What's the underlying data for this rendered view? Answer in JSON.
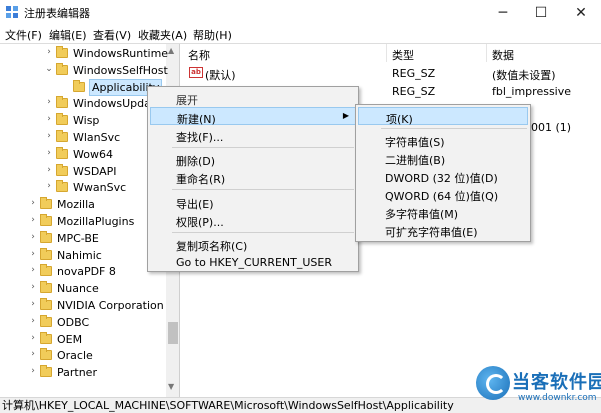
{
  "window": {
    "title": "注册表编辑器"
  },
  "menubar": [
    "文件(F)",
    "编辑(E)",
    "查看(V)",
    "收藏夹(A)",
    "帮助(H)"
  ],
  "tree": [
    {
      "label": "WindowsRuntime",
      "arrow": "›"
    },
    {
      "label": "WindowsSelfHost",
      "arrow": "⌄"
    },
    {
      "label": "Applicability",
      "arrow": "",
      "selected": true
    },
    {
      "label": "WindowsUpdat",
      "arrow": "›"
    },
    {
      "label": "Wisp",
      "arrow": "›"
    },
    {
      "label": "WlanSvc",
      "arrow": "›"
    },
    {
      "label": "Wow64",
      "arrow": "›"
    },
    {
      "label": "WSDAPI",
      "arrow": "›"
    },
    {
      "label": "WwanSvc",
      "arrow": "›"
    },
    {
      "label": "Mozilla",
      "arrow": "›"
    },
    {
      "label": "MozillaPlugins",
      "arrow": "›"
    },
    {
      "label": "MPC-BE",
      "arrow": "›"
    },
    {
      "label": "Nahimic",
      "arrow": "›"
    },
    {
      "label": "novaPDF 8",
      "arrow": "›"
    },
    {
      "label": "Nuance",
      "arrow": "›"
    },
    {
      "label": "NVIDIA Corporation",
      "arrow": "›"
    },
    {
      "label": "ODBC",
      "arrow": "›"
    },
    {
      "label": "OEM",
      "arrow": "›"
    },
    {
      "label": "Oracle",
      "arrow": "›"
    },
    {
      "label": "Partner",
      "arrow": "›"
    }
  ],
  "columns": {
    "name": "名称",
    "type": "类型",
    "data": "数据"
  },
  "values": [
    {
      "icon": "ab",
      "name": "(默认)",
      "type": "REG_SZ",
      "data": "(数值未设置)"
    },
    {
      "icon": "",
      "name": "",
      "type": "REG_SZ",
      "data": "fbl_impressive"
    },
    {
      "icon": "",
      "name": "",
      "type": "",
      "data": "001 (1)"
    }
  ],
  "context_menu": {
    "header": "展开",
    "new": "新建(N)",
    "find": "查找(F)...",
    "delete": "删除(D)",
    "rename": "重命名(R)",
    "export": "导出(E)",
    "permissions": "权限(P)...",
    "copy_key": "复制项名称(C)",
    "goto": "Go to HKEY_CURRENT_USER"
  },
  "submenu": {
    "key": "项(K)",
    "string": "字符串值(S)",
    "binary": "二进制值(B)",
    "dword": "DWORD (32 位)值(D)",
    "qword": "QWORD (64 位)值(Q)",
    "multi": "多字符串值(M)",
    "expand": "可扩充字符串值(E)"
  },
  "statusbar": "计算机\\HKEY_LOCAL_MACHINE\\SOFTWARE\\Microsoft\\WindowsSelfHost\\Applicability",
  "watermark": {
    "title": "当客软件园",
    "url": "www.downkr.com"
  },
  "icons": {
    "app": "regedit-icon",
    "minimize": "─",
    "maximize": "☐",
    "close": "✕",
    "submenu_arrow": "▶",
    "scroll_up": "▲",
    "scroll_down": "▼"
  }
}
